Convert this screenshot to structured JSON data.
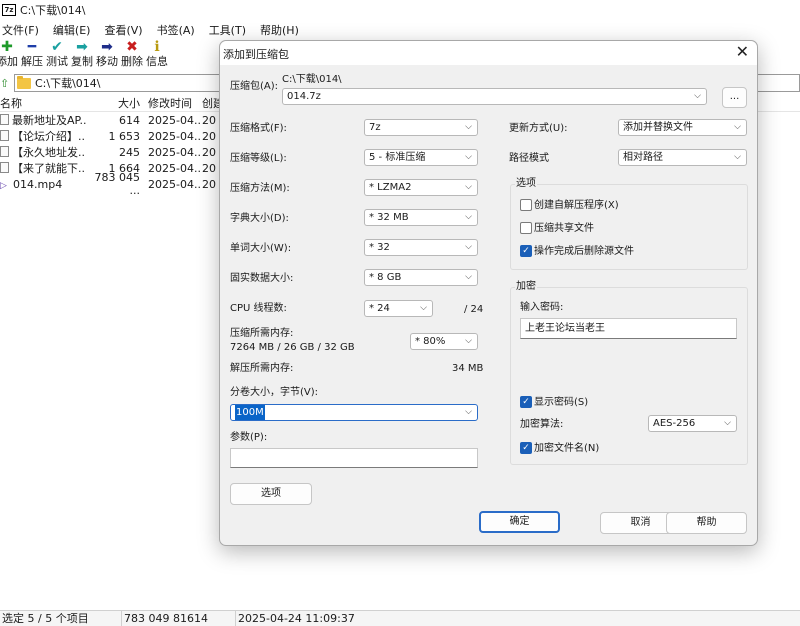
{
  "window": {
    "app_icon_text": "7z",
    "title": "C:\\下载\\014\\"
  },
  "menu": [
    "文件(F)",
    "编辑(E)",
    "查看(V)",
    "书签(A)",
    "工具(T)",
    "帮助(H)"
  ],
  "toolbar": {
    "add": "添加",
    "extract": "解压",
    "test": "测试",
    "copy": "复制",
    "move": "移动",
    "delete": "删除",
    "info": "信息"
  },
  "address": "C:\\下载\\014\\",
  "columns": {
    "name": "名称",
    "size": "大小",
    "modified": "修改时间",
    "created": "创建"
  },
  "files": [
    {
      "name": "最新地址及AP...",
      "size": "614",
      "modified": "2025-04...",
      "created": "20",
      "type": "doc"
    },
    {
      "name": "【论坛介绍】....",
      "size": "1 653",
      "modified": "2025-04...",
      "created": "20",
      "type": "doc"
    },
    {
      "name": "【永久地址发...",
      "size": "245",
      "modified": "2025-04...",
      "created": "20",
      "type": "doc"
    },
    {
      "name": "【来了就能下...",
      "size": "1 664",
      "modified": "2025-04...",
      "created": "20",
      "type": "doc"
    },
    {
      "name": "014.mp4",
      "size": "783 045 ...",
      "modified": "2025-04...",
      "created": "20",
      "type": "video"
    }
  ],
  "status": {
    "selection": "选定 5 / 5 个项目",
    "size": "783 049 81614",
    "date": "2025-04-24 11:09:37"
  },
  "dialog": {
    "title": "添加到压缩包",
    "archive_label": "压缩包(A):",
    "archive_path": "C:\\下载\\014\\",
    "archive_name": "014.7z",
    "browse": "...",
    "format_label": "压缩格式(F):",
    "format_value": "7z",
    "level_label": "压缩等级(L):",
    "level_value": "5 - 标准压缩",
    "method_label": "压缩方法(M):",
    "method_value": "* LZMA2",
    "dict_label": "字典大小(D):",
    "dict_value": "* 32 MB",
    "word_label": "单词大小(W):",
    "word_value": "* 32",
    "solid_label": "固实数据大小:",
    "solid_value": "* 8 GB",
    "cpu_label": "CPU 线程数:",
    "cpu_value": "* 24",
    "cpu_max": "/ 24",
    "mem_comp_label": "压缩所需内存:",
    "mem_comp_detail": "7264 MB / 26 GB / 32 GB",
    "mem_comp_value": "* 80%",
    "mem_decomp_label": "解压所需内存:",
    "mem_decomp_value": "34 MB",
    "split_label": "分卷大小，字节(V):",
    "split_value": "100M",
    "params_label": "参数(P):",
    "params_value": "",
    "options_button": "选项",
    "update_label": "更新方式(U):",
    "update_value": "添加并替换文件",
    "path_label": "路径模式",
    "path_value": "相对路径",
    "options_group": "选项",
    "opt_sfx": "创建自解压程序(X)",
    "opt_sfx_checked": false,
    "opt_shared": "压缩共享文件",
    "opt_shared_checked": false,
    "opt_delete": "操作完成后删除源文件",
    "opt_delete_checked": true,
    "encrypt_group": "加密",
    "password_label": "输入密码:",
    "password_value": "上老王论坛当老王",
    "show_password": "显示密码(S)",
    "show_password_checked": true,
    "enc_method_label": "加密算法:",
    "enc_method_value": "AES-256",
    "encrypt_names": "加密文件名(N)",
    "encrypt_names_checked": true,
    "ok": "确定",
    "cancel": "取消",
    "help": "帮助"
  }
}
